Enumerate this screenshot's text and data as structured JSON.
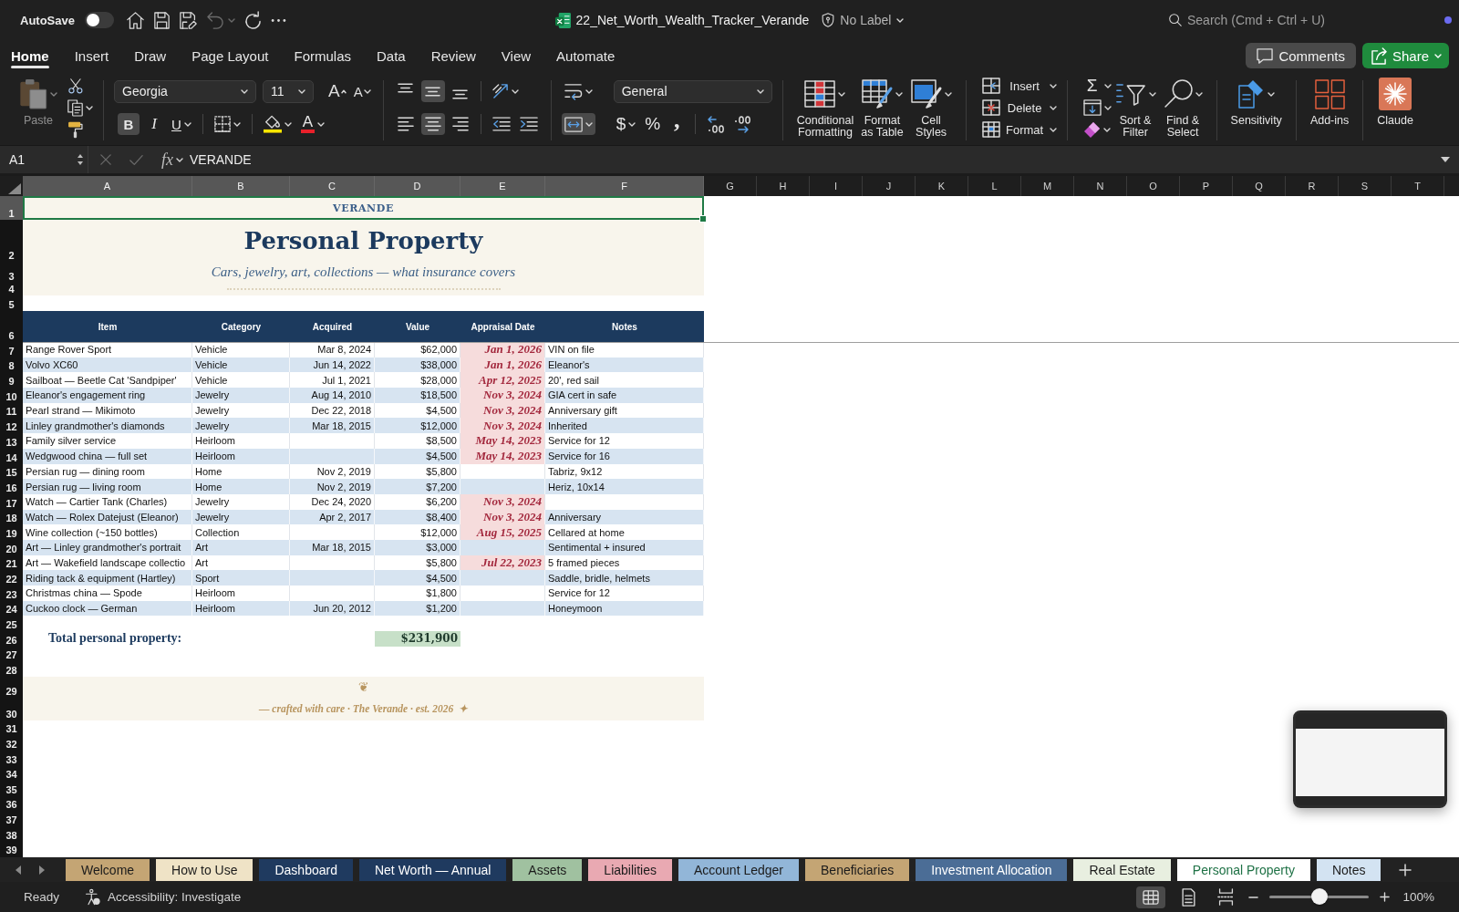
{
  "title_bar": {
    "autosave": {
      "label": "AutoSave",
      "on": false
    },
    "undo": {
      "disabled": true
    },
    "file_name": "22_Net_Worth_Wealth_Tracker_Verande",
    "sensitivity_label": "No Label",
    "search": {
      "placeholder": "Search (Cmd + Ctrl + U)"
    }
  },
  "ribbon": {
    "tabs": [
      {
        "label": "Home",
        "selected": true
      },
      {
        "label": "Insert",
        "selected": false
      },
      {
        "label": "Draw",
        "selected": false
      },
      {
        "label": "Page Layout",
        "selected": false
      },
      {
        "label": "Formulas",
        "selected": false
      },
      {
        "label": "Data",
        "selected": false
      },
      {
        "label": "Review",
        "selected": false
      },
      {
        "label": "View",
        "selected": false
      },
      {
        "label": "Automate",
        "selected": false
      }
    ],
    "comments": "Comments",
    "share": "Share",
    "paste": {
      "label": "Paste",
      "disabled": true
    },
    "font": {
      "name": "Georgia",
      "size": "11",
      "grow_glyph": "A",
      "shrink_glyph": "A",
      "color_glyph": "A",
      "styles": [
        {
          "kind": "bold",
          "glyph": "B",
          "on": true
        },
        {
          "kind": "italic",
          "glyph": "I",
          "on": false
        },
        {
          "kind": "underline",
          "glyph": "U",
          "on": false
        }
      ]
    },
    "vertical_align": [
      {
        "kind": "top",
        "selected": false
      },
      {
        "kind": "middle",
        "selected": true
      },
      {
        "kind": "bottom",
        "selected": false
      }
    ],
    "horizontal_align": [
      {
        "kind": "left",
        "selected": false
      },
      {
        "kind": "center",
        "selected": true
      },
      {
        "kind": "right",
        "selected": false
      }
    ],
    "merge": {
      "on": true
    },
    "number": {
      "format": "General",
      "symbols": [
        {
          "kind": "currency",
          "glyph": "$"
        },
        {
          "kind": "percent",
          "glyph": "%"
        },
        {
          "kind": "comma",
          "glyph": ","
        }
      ]
    },
    "styles": [
      {
        "kind": "conditional",
        "label": "Conditional\nFormatting"
      },
      {
        "kind": "table",
        "label": "Format\nas Table"
      },
      {
        "kind": "cell",
        "label": "Cell\nStyles"
      }
    ],
    "cells": [
      {
        "kind": "insert",
        "label": "Insert"
      },
      {
        "kind": "delete",
        "label": "Delete"
      },
      {
        "kind": "format",
        "label": "Format"
      }
    ],
    "autosum_glyph": "Σ",
    "editing": [
      {
        "kind": "sort",
        "label": "Sort &\nFilter"
      },
      {
        "kind": "find",
        "label": "Find &\nSelect"
      }
    ],
    "extras": [
      {
        "kind": "sensitivity",
        "label": "Sensitivity"
      },
      {
        "kind": "addins",
        "label": "Add-ins"
      },
      {
        "kind": "claude",
        "label": "Claude"
      }
    ]
  },
  "formula_bar": {
    "name_box": "A1",
    "editing": false,
    "fx": "fx",
    "formula": "VERANDE"
  },
  "sheet": {
    "column_headers": [
      {
        "label": "A",
        "selected": true
      },
      {
        "label": "B",
        "selected": true
      },
      {
        "label": "C",
        "selected": true
      },
      {
        "label": "D",
        "selected": true
      },
      {
        "label": "E",
        "selected": true
      },
      {
        "label": "F",
        "selected": true
      },
      {
        "label": "G",
        "selected": false
      },
      {
        "label": "H",
        "selected": false
      },
      {
        "label": "I",
        "selected": false
      },
      {
        "label": "J",
        "selected": false
      },
      {
        "label": "K",
        "selected": false
      },
      {
        "label": "L",
        "selected": false
      },
      {
        "label": "M",
        "selected": false
      },
      {
        "label": "N",
        "selected": false
      },
      {
        "label": "O",
        "selected": false
      },
      {
        "label": "P",
        "selected": false
      },
      {
        "label": "Q",
        "selected": false
      },
      {
        "label": "R",
        "selected": false
      },
      {
        "label": "S",
        "selected": false
      },
      {
        "label": "T",
        "selected": false
      }
    ],
    "row_headers": [
      {
        "label": "1",
        "selected": true
      },
      {
        "label": "2",
        "selected": false
      },
      {
        "label": "3",
        "selected": false
      },
      {
        "label": "4",
        "selected": false
      },
      {
        "label": "5",
        "selected": false
      },
      {
        "label": "6",
        "selected": false
      },
      {
        "label": "7",
        "selected": false
      },
      {
        "label": "8",
        "selected": false
      },
      {
        "label": "9",
        "selected": false
      },
      {
        "label": "10",
        "selected": false
      },
      {
        "label": "11",
        "selected": false
      },
      {
        "label": "12",
        "selected": false
      },
      {
        "label": "13",
        "selected": false
      },
      {
        "label": "14",
        "selected": false
      },
      {
        "label": "15",
        "selected": false
      },
      {
        "label": "16",
        "selected": false
      },
      {
        "label": "17",
        "selected": false
      },
      {
        "label": "18",
        "selected": false
      },
      {
        "label": "19",
        "selected": false
      },
      {
        "label": "20",
        "selected": false
      },
      {
        "label": "21",
        "selected": false
      },
      {
        "label": "22",
        "selected": false
      },
      {
        "label": "23",
        "selected": false
      },
      {
        "label": "24",
        "selected": false
      },
      {
        "label": "25",
        "selected": false
      },
      {
        "label": "26",
        "selected": false
      },
      {
        "label": "27",
        "selected": false
      },
      {
        "label": "28",
        "selected": false
      },
      {
        "label": "29",
        "selected": false
      },
      {
        "label": "30",
        "selected": false
      },
      {
        "label": "31",
        "selected": false
      },
      {
        "label": "32",
        "selected": false
      },
      {
        "label": "33",
        "selected": false
      },
      {
        "label": "34",
        "selected": false
      },
      {
        "label": "35",
        "selected": false
      },
      {
        "label": "36",
        "selected": false
      },
      {
        "label": "37",
        "selected": false
      },
      {
        "label": "38",
        "selected": false
      },
      {
        "label": "39",
        "selected": false
      }
    ],
    "brand_cell": {
      "text": "VERANDE",
      "selected": true
    },
    "title": "Personal Property",
    "subtitle": "Cars, jewelry, art, collections — what insurance covers",
    "table": {
      "columns": [
        "Item",
        "Category",
        "Acquired",
        "Value",
        "Appraisal Date",
        "Notes"
      ],
      "rows": [
        {
          "item": "Range Rover Sport",
          "category": "Vehicle",
          "acquired": "Mar 8, 2024",
          "value": "$62,000",
          "appraisal_date": "Jan 1, 2026",
          "notes": "VIN on file"
        },
        {
          "item": "Volvo XC60",
          "category": "Vehicle",
          "acquired": "Jun 14, 2022",
          "value": "$38,000",
          "appraisal_date": "Jan 1, 2026",
          "notes": "Eleanor's"
        },
        {
          "item": "Sailboat — Beetle Cat 'Sandpiper'",
          "category": "Vehicle",
          "acquired": "Jul 1, 2021",
          "value": "$28,000",
          "appraisal_date": "Apr 12, 2025",
          "notes": "20', red sail"
        },
        {
          "item": "Eleanor's engagement ring",
          "category": "Jewelry",
          "acquired": "Aug 14, 2010",
          "value": "$18,500",
          "appraisal_date": "Nov 3, 2024",
          "notes": "GIA cert in safe"
        },
        {
          "item": "Pearl strand — Mikimoto",
          "category": "Jewelry",
          "acquired": "Dec 22, 2018",
          "value": "$4,500",
          "appraisal_date": "Nov 3, 2024",
          "notes": "Anniversary gift"
        },
        {
          "item": "Linley grandmother's diamonds",
          "category": "Jewelry",
          "acquired": "Mar 18, 2015",
          "value": "$12,000",
          "appraisal_date": "Nov 3, 2024",
          "notes": "Inherited"
        },
        {
          "item": "Family silver service",
          "category": "Heirloom",
          "value": "$8,500",
          "appraisal_date": "May 14, 2023",
          "notes": "Service for 12"
        },
        {
          "item": "Wedgwood china — full set",
          "category": "Heirloom",
          "value": "$4,500",
          "appraisal_date": "May 14, 2023",
          "notes": "Service for 16"
        },
        {
          "item": "Persian rug — dining room",
          "category": "Home",
          "acquired": "Nov 2, 2019",
          "value": "$5,800",
          "notes": "Tabriz, 9x12"
        },
        {
          "item": "Persian rug — living room",
          "category": "Home",
          "acquired": "Nov 2, 2019",
          "value": "$7,200",
          "notes": "Heriz, 10x14"
        },
        {
          "item": "Watch — Cartier Tank (Charles)",
          "category": "Jewelry",
          "acquired": "Dec 24, 2020",
          "value": "$6,200",
          "appraisal_date": "Nov 3, 2024"
        },
        {
          "item": "Watch — Rolex Datejust (Eleanor)",
          "category": "Jewelry",
          "acquired": "Apr 2, 2017",
          "value": "$8,400",
          "appraisal_date": "Nov 3, 2024",
          "notes": "Anniversary"
        },
        {
          "item": "Wine collection (~150 bottles)",
          "category": "Collection",
          "value": "$12,000",
          "appraisal_date": "Aug 15, 2025",
          "notes": "Cellared at home"
        },
        {
          "item": "Art — Linley grandmother's portrait",
          "category": "Art",
          "acquired": "Mar 18, 2015",
          "value": "$3,000",
          "notes": "Sentimental + insured"
        },
        {
          "item": "Art — Wakefield landscape collectio",
          "category": "Art",
          "value": "$5,800",
          "appraisal_date": "Jul 22, 2023",
          "notes": "5 framed pieces"
        },
        {
          "item": "Riding tack & equipment (Hartley)",
          "category": "Sport",
          "value": "$4,500",
          "notes": "Saddle, bridle, helmets"
        },
        {
          "item": "Christmas china — Spode",
          "category": "Heirloom",
          "value": "$1,800",
          "notes": "Service for 12"
        },
        {
          "item": "Cuckoo clock — German",
          "category": "Heirloom",
          "acquired": "Jun 20, 2012",
          "value": "$1,200",
          "notes": "Honeymoon"
        }
      ]
    },
    "total": {
      "label": "Total personal property:",
      "value": "$231,900"
    },
    "footer": {
      "ornament": "❦",
      "text": "— crafted with care · The Verande · est. 2026  ✦"
    }
  },
  "sheet_tabs": [
    {
      "label": "Welcome",
      "color": "#c4a574",
      "selected": false
    },
    {
      "label": "How to Use",
      "color": "#efe3c6",
      "selected": false
    },
    {
      "label": "Dashboard",
      "color": "#1f3a5f",
      "selected": false
    },
    {
      "label": "Net Worth — Annual",
      "color": "#1f3a5f",
      "selected": false
    },
    {
      "label": "Assets",
      "color": "#a0c1a0",
      "selected": false
    },
    {
      "label": "Liabilities",
      "color": "#e9a9b2",
      "selected": false
    },
    {
      "label": "Account Ledger",
      "color": "#92b6d8",
      "selected": false
    },
    {
      "label": "Beneficiaries",
      "color": "#c4a574",
      "selected": false
    },
    {
      "label": "Investment Allocation",
      "color": "#4b6d96",
      "selected": false
    },
    {
      "label": "Real Estate",
      "color": "#e8efe0",
      "selected": false
    },
    {
      "label": "Personal Property",
      "selected": true
    },
    {
      "label": "Notes",
      "color": "#d3e3f2",
      "selected": false
    }
  ],
  "status_bar": {
    "status": "Ready",
    "accessibility": "Accessibility: Investigate",
    "views": [
      {
        "kind": "normal",
        "selected": true
      },
      {
        "kind": "page_layout",
        "selected": false
      },
      {
        "kind": "page_break",
        "selected": false
      }
    ],
    "zoom": {
      "level": 0.5,
      "reading": "100%"
    }
  }
}
